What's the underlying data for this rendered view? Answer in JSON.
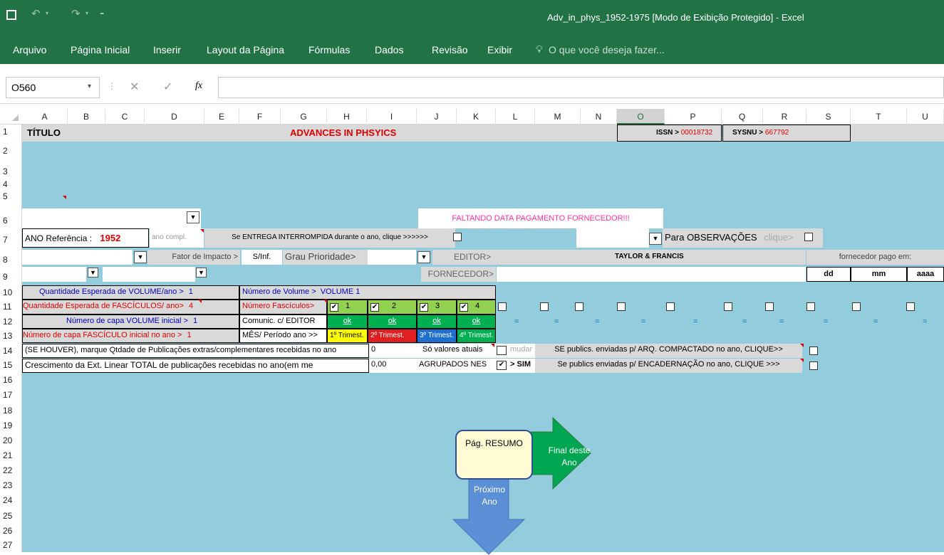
{
  "window": {
    "title": "Adv_in_phys_1952-1975  [Modo de Exibição Protegido] - Excel"
  },
  "ribbon": {
    "tabs": [
      "Arquivo",
      "Página Inicial",
      "Inserir",
      "Layout da Página",
      "Fórmulas",
      "Dados",
      "Revisão",
      "Exibir"
    ],
    "tell_me": "O que você deseja fazer..."
  },
  "formula_bar": {
    "name_box": "O560",
    "fx": "fx",
    "content": ""
  },
  "columns": [
    "A",
    "B",
    "C",
    "D",
    "E",
    "F",
    "G",
    "H",
    "I",
    "J",
    "K",
    "L",
    "M",
    "N",
    "O",
    "P",
    "Q",
    "R",
    "S",
    "T",
    "U"
  ],
  "rows": [
    "1",
    "2",
    "3",
    "4",
    "5",
    "6",
    "7",
    "8",
    "9",
    "10",
    "11",
    "12",
    "13",
    "14",
    "15",
    "16",
    "17",
    "18",
    "19",
    "20",
    "21",
    "22",
    "23",
    "24",
    "25",
    "26",
    "27"
  ],
  "sheet": {
    "r1": {
      "titulo": "TÍTULO",
      "journal": "ADVANCES IN PHSYICS",
      "issn_label": "ISSN >",
      "issn": "00018732",
      "sysnu_label": "SYSNU >",
      "sysnu": "667792"
    },
    "r6": {
      "alert": "FALTANDO DATA PAGAMENTO FORNECEDOR!!!"
    },
    "r7": {
      "ano_label": "ANO Referência :",
      "ano": "1952",
      "ano_compl": "ano compl.",
      "entrega": "Se ENTREGA INTERROMPIDA durante o ano, clique >>>>>>",
      "obs": "Para OBSERVAÇÕES",
      "clique": "clique>"
    },
    "r8": {
      "fator": "Fator de Impacto >",
      "sinf": "S/Inf.",
      "grau": "Grau Prioridade>",
      "editor_label": "EDITOR>",
      "editor": "TAYLOR & FRANCIS",
      "pago": "fornecedor pago em:"
    },
    "r9": {
      "fornecedor_label": "FORNECEDOR>",
      "dd": "dd",
      "mm": "mm",
      "aaaa": "aaaa"
    },
    "r10": {
      "qtd_vol": "Quantidade Esperada de VOLUME/ano >",
      "qtd_vol_val": "1",
      "num_vol": "Número de Volume >",
      "num_vol_val": "VOLUME  1"
    },
    "r11": {
      "qtd_fasc": "Quantidade Esperada de FASCÍCULOS/ ano>",
      "qtd_fasc_val": "4",
      "num_fasc": "Número Fascículos>",
      "f1": "1",
      "f2": "2",
      "f3": "3",
      "f4": "4"
    },
    "r12": {
      "capa_vol": "Número de capa VOLUME inicial  >",
      "capa_vol_val": "1",
      "comunic": "Comunic. c/ EDITOR",
      "ok": "ok",
      "dash": "="
    },
    "r13": {
      "capa_fasc": "Número de capa FASCÍCULO inicial no ano >",
      "capa_fasc_val": "1",
      "mes": "MÊS/ Período ano >>",
      "t1": "1º Trimest.",
      "t2": "2º Trimest.",
      "t3": "3º Trimest.",
      "t4": "4º Trimest."
    },
    "r14": {
      "extras": "(SE HOUVER), marque Qtdade de Publicações extras/complementares recebidas no ano",
      "extras_val": "0",
      "so_valores": "Só valores atuais",
      "mudar": "mudar",
      "compact": "SE publics. enviadas p/ ARQ. COMPACTADO no ano, CLIQUE>>"
    },
    "r15": {
      "cresc": "Crescimento da Ext. Linear TOTAL de publicações recebidas no ano(em me",
      "cresc_val": "0,00",
      "agrup": "AGRUPADOS NES",
      "sim": "> SIM",
      "encad": "Se publics enviadas p/ ENCADERNAÇÃO no ano, CLIQUE >>>"
    }
  },
  "shapes": {
    "resumo": "Pág. RESUMO",
    "final": "Final deste Ano",
    "proximo": "Próximo Ano"
  },
  "colors": {
    "excel_green": "#217346",
    "sheet_bg": "#93cddd",
    "green_cell": "#92d050",
    "red_text": "#e00000"
  }
}
